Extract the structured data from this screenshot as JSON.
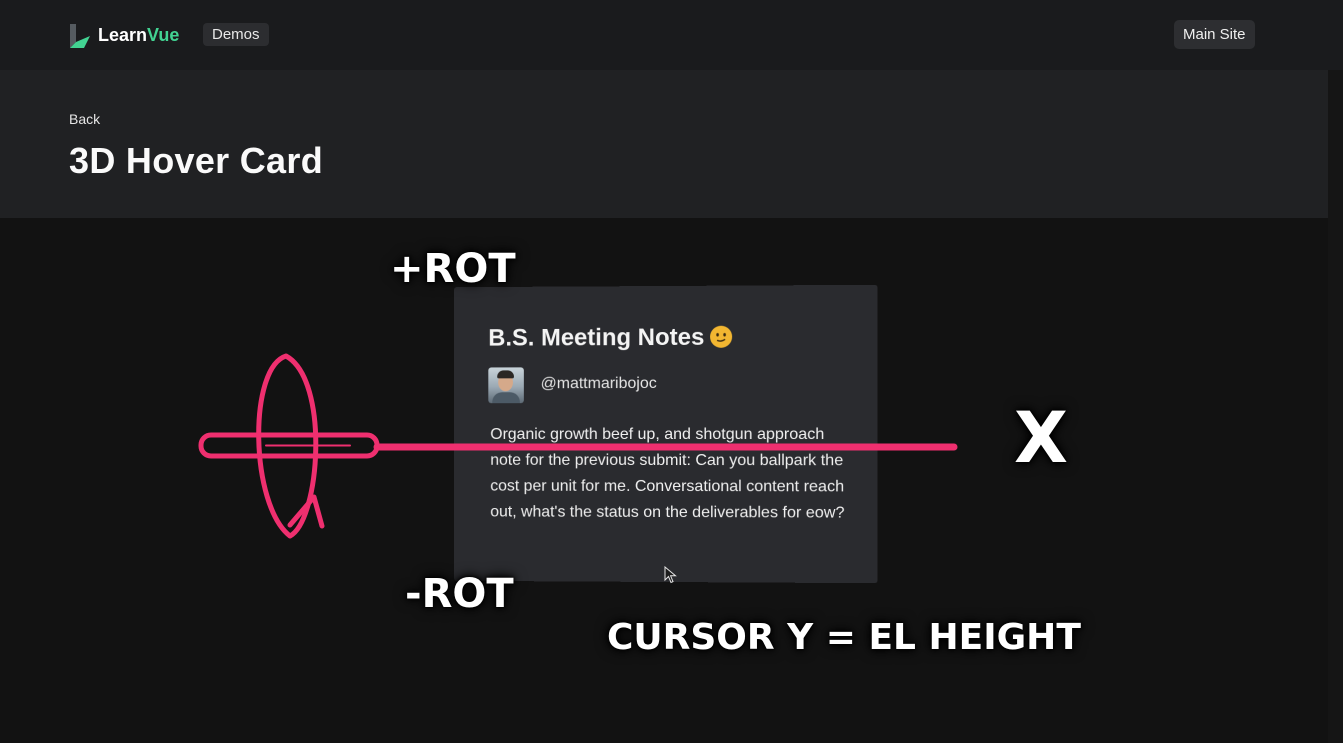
{
  "topbar": {
    "logo_learn": "Learn",
    "logo_vue": "Vue",
    "demos_badge": "Demos",
    "main_site_label": "Main Site"
  },
  "header": {
    "back_label": "Back",
    "title": "3D Hover Card"
  },
  "card": {
    "title": "B.S. Meeting Notes",
    "emoji_icon": "smiling-face-emoji",
    "username": "@mattmaribojoc",
    "body": "Organic growth beef up, and shotgun approach note for the previous submit: Can you ballpark the cost per unit for me. Conversational content reach out, what's the status on the deliverables for eow?"
  },
  "annotations": {
    "plus_rot": "+ROT",
    "minus_rot": "-ROT",
    "x_axis": "X",
    "cursor_rule": "CURSOR Y = EL HEIGHT"
  },
  "colors": {
    "accent_green": "#42d392",
    "annotation_pink": "#ef2f6f",
    "page_bg": "#121212",
    "card_bg": "#2a2b2f"
  }
}
